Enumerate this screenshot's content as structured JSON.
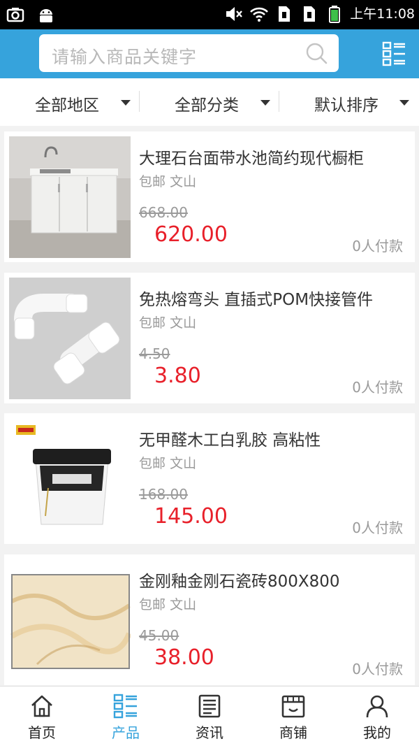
{
  "status_bar": {
    "time": "上午11:08",
    "icons": [
      "screenshot-icon",
      "android-icon",
      "mute-icon",
      "wifi-icon",
      "sim1-icon",
      "sim2-icon",
      "battery-icon"
    ]
  },
  "header": {
    "search_placeholder": "请输入商品关键字",
    "search_icon": "search-icon",
    "menu_icon": "grid-menu-icon",
    "color": "#36a3dc"
  },
  "filters": [
    {
      "label": "全部地区"
    },
    {
      "label": "全部分类"
    },
    {
      "label": "默认排序"
    }
  ],
  "products": [
    {
      "title": "大理石台面带水池简约现代橱柜",
      "tag": "包邮",
      "location": "文山",
      "original_price": "668.00",
      "price": "620.00",
      "paid_count": "0人付款",
      "image": "cabinet-sink"
    },
    {
      "title": "免热熔弯头 直插式POM快接管件",
      "tag": "包邮",
      "location": "文山",
      "original_price": "4.50",
      "price": "3.80",
      "paid_count": "0人付款",
      "image": "pipe-fittings"
    },
    {
      "title": "无甲醛木工白乳胶 高粘性",
      "tag": "包邮",
      "location": "文山",
      "original_price": "168.00",
      "price": "145.00",
      "paid_count": "0人付款",
      "image": "glue-bucket"
    },
    {
      "title": "金刚釉金刚石瓷砖800X800",
      "tag": "包邮",
      "location": "文山",
      "original_price": "45.00",
      "price": "38.00",
      "paid_count": "0人付款",
      "image": "marble-tile"
    }
  ],
  "tabbar": [
    {
      "label": "首页",
      "icon": "home-icon",
      "active": false
    },
    {
      "label": "产品",
      "icon": "products-icon",
      "active": true
    },
    {
      "label": "资讯",
      "icon": "news-icon",
      "active": false
    },
    {
      "label": "商铺",
      "icon": "store-icon",
      "active": false
    },
    {
      "label": "我的",
      "icon": "user-icon",
      "active": false
    }
  ],
  "colors": {
    "accent": "#36a3dc",
    "price": "#e8202a"
  }
}
